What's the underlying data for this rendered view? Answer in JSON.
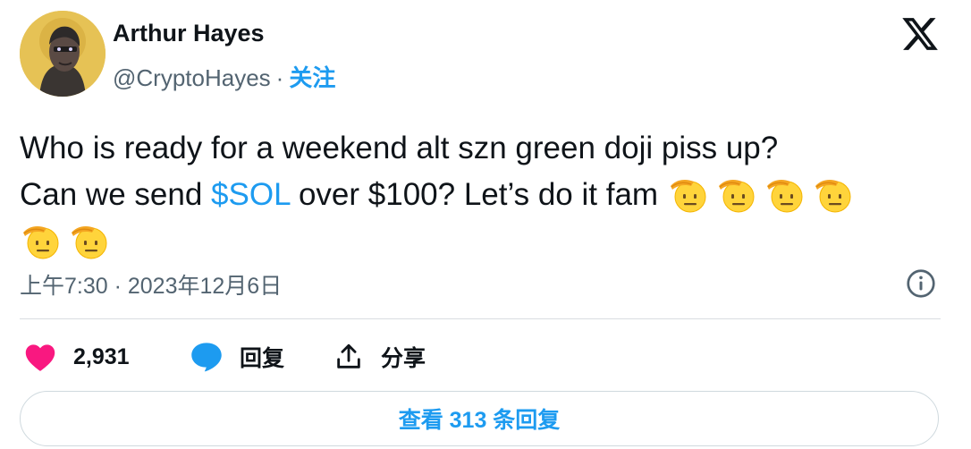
{
  "author": {
    "name": "Arthur Hayes",
    "handle": "@CryptoHayes",
    "separator": "·",
    "follow_label": "关注"
  },
  "icons": {
    "brand": "x-logo-icon",
    "info": "info-icon",
    "like": "heart-icon",
    "reply": "reply-bubble-icon",
    "share": "share-upload-icon",
    "emoji": "saluting-face-emoji"
  },
  "tweet": {
    "line1": "Who is ready for a weekend alt szn green doji piss up?",
    "line2_prefix": "Can we send ",
    "cashtag": "$SOL",
    "line2_suffix": " over $100? Let’s do it fam ",
    "emoji_count": 6
  },
  "meta": {
    "timestamp": "上午7:30 · 2023年12月6日"
  },
  "actions": {
    "like_count": "2,931",
    "reply_label": "回复",
    "share_label": "分享"
  },
  "replies_button": "查看 313 条回复",
  "colors": {
    "accent": "#1d9bf0",
    "like": "#f91880",
    "text": "#0f1419",
    "muted": "#536471"
  }
}
